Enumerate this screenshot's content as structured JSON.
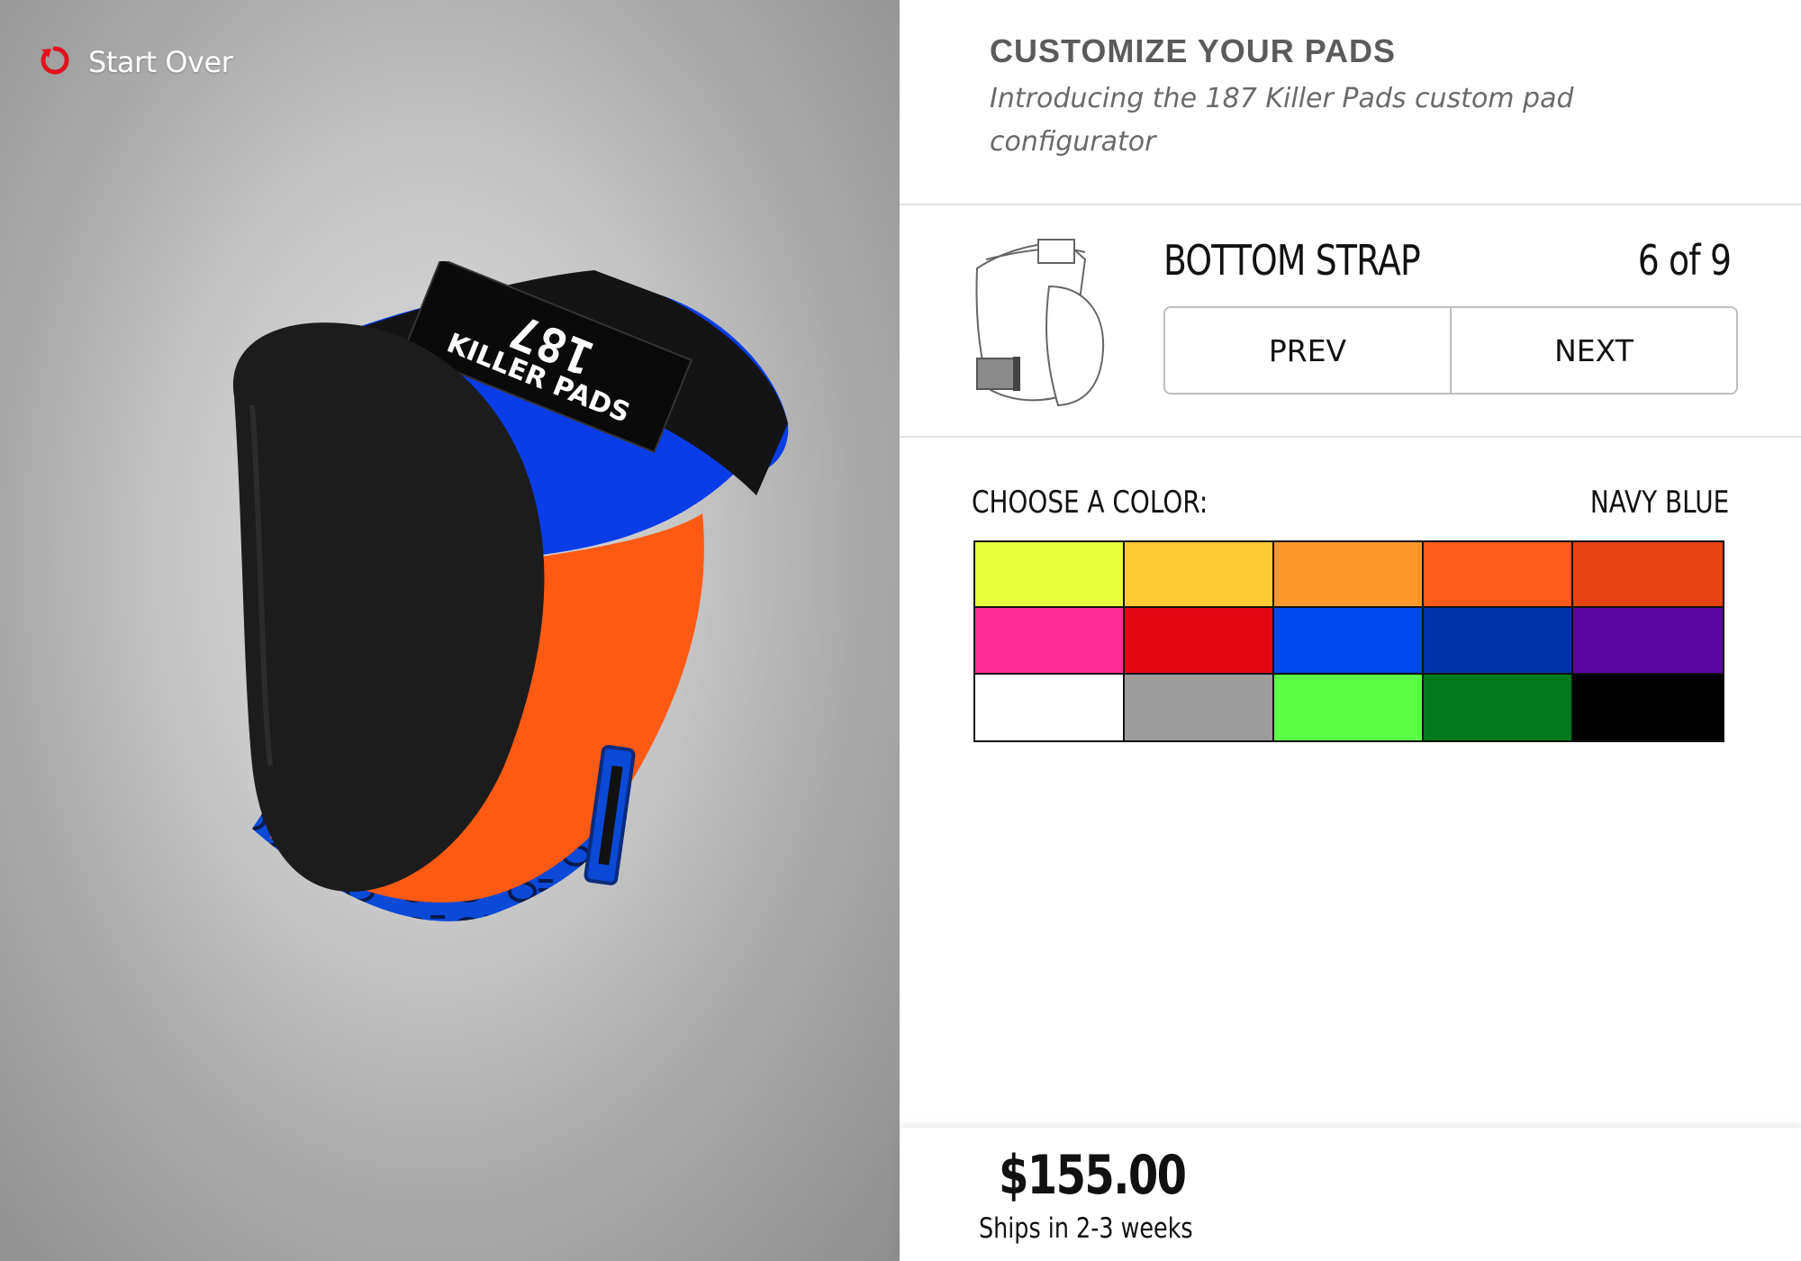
{
  "preview": {
    "start_over_label": "Start Over",
    "start_over_icon": "restart-icon",
    "start_over_icon_color": "#e0141e",
    "product_image": {
      "strap_logo_number": "187",
      "strap_logo_text": "KILLER PADS",
      "colors": {
        "cap": "#1c1c1c",
        "upper_body": "#0a3de8",
        "lower_body": "#ff5a14",
        "top_strap": "#141414",
        "bottom_strap": "#0b49d6"
      }
    }
  },
  "header": {
    "title": "CUSTOMIZE YOUR PADS",
    "subtitle": "Introducing the 187 Killer Pads custom pad configurator"
  },
  "step": {
    "name": "BOTTOM STRAP",
    "counter": "6 of 9",
    "prev_label": "PREV",
    "next_label": "NEXT"
  },
  "color_picker": {
    "label": "CHOOSE A COLOR:",
    "selected": "NAVY BLUE",
    "swatches": [
      "#e6ff3a",
      "#ffca33",
      "#ff982a",
      "#ff5b1a",
      "#e84314",
      "#ff2a93",
      "#e20613",
      "#0048ee",
      "#0033aa",
      "#5d07a3",
      "#ffffff",
      "#9c9c9c",
      "#5cff45",
      "#007a1c",
      "#000000"
    ]
  },
  "footer": {
    "price": "$155.00",
    "shipping": "Ships in 2-3 weeks"
  }
}
